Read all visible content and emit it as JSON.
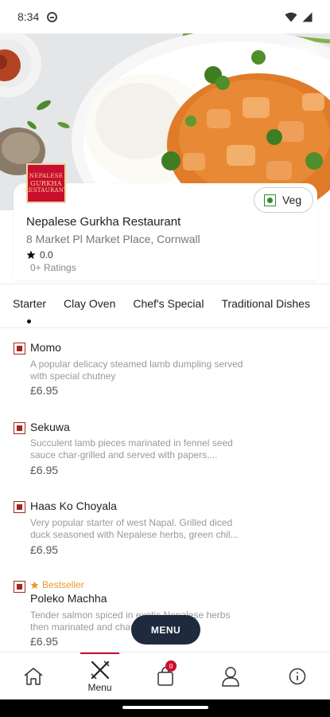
{
  "status_bar": {
    "time": "8:34"
  },
  "restaurant": {
    "logo_lines": [
      "NEPALESE",
      "GURKHA",
      "RESTAURANT"
    ],
    "name": "Nepalese Gurkha Restaurant",
    "address": "8 Market Pl Market Place, Cornwall",
    "rating": "0.0",
    "ratings_count": "0+ Ratings"
  },
  "veg_toggle": {
    "label": "Veg"
  },
  "tabs": [
    {
      "label": "Starter",
      "active": true
    },
    {
      "label": "Clay Oven"
    },
    {
      "label": "Chef's Special"
    },
    {
      "label": "Traditional Dishes"
    }
  ],
  "menu_items": [
    {
      "name": "Momo",
      "description": "A popular delicacy steamed lamb dumpling served with special chutney",
      "price": "£6.95"
    },
    {
      "name": "Sekuwa",
      "description": "Succulent lamb pieces marinated in fennel seed sauce char-grilled and served with papers,...",
      "price": "£6.95"
    },
    {
      "name": "Haas Ko Choyala",
      "description": "Very popular starter of west Napal. Grilled diced duck seasoned with Nepalese herbs, green chil...",
      "price": "£6.95"
    },
    {
      "badge": "Bestseller",
      "name": "Poleko Machha",
      "description": "Tender salmon spiced in exotic Nepalese herbs then marinated and char...",
      "price": "£6.95"
    }
  ],
  "menu_fab": {
    "label": "MENU"
  },
  "bottom_nav": {
    "home": "",
    "menu": "Menu",
    "cart_count": "0",
    "profile": "",
    "info": ""
  },
  "colors": {
    "brand": "#c8102e",
    "fab": "#1f2a3c",
    "veg": "#2e8b2e",
    "nonveg": "#a0281a",
    "bestseller": "#e89a2c"
  },
  "icons": [
    "wifi-icon",
    "signal-icon",
    "search-icon",
    "star-icon",
    "home-icon",
    "fork-knife-icon",
    "shopping-bag-icon",
    "user-icon",
    "info-icon"
  ]
}
